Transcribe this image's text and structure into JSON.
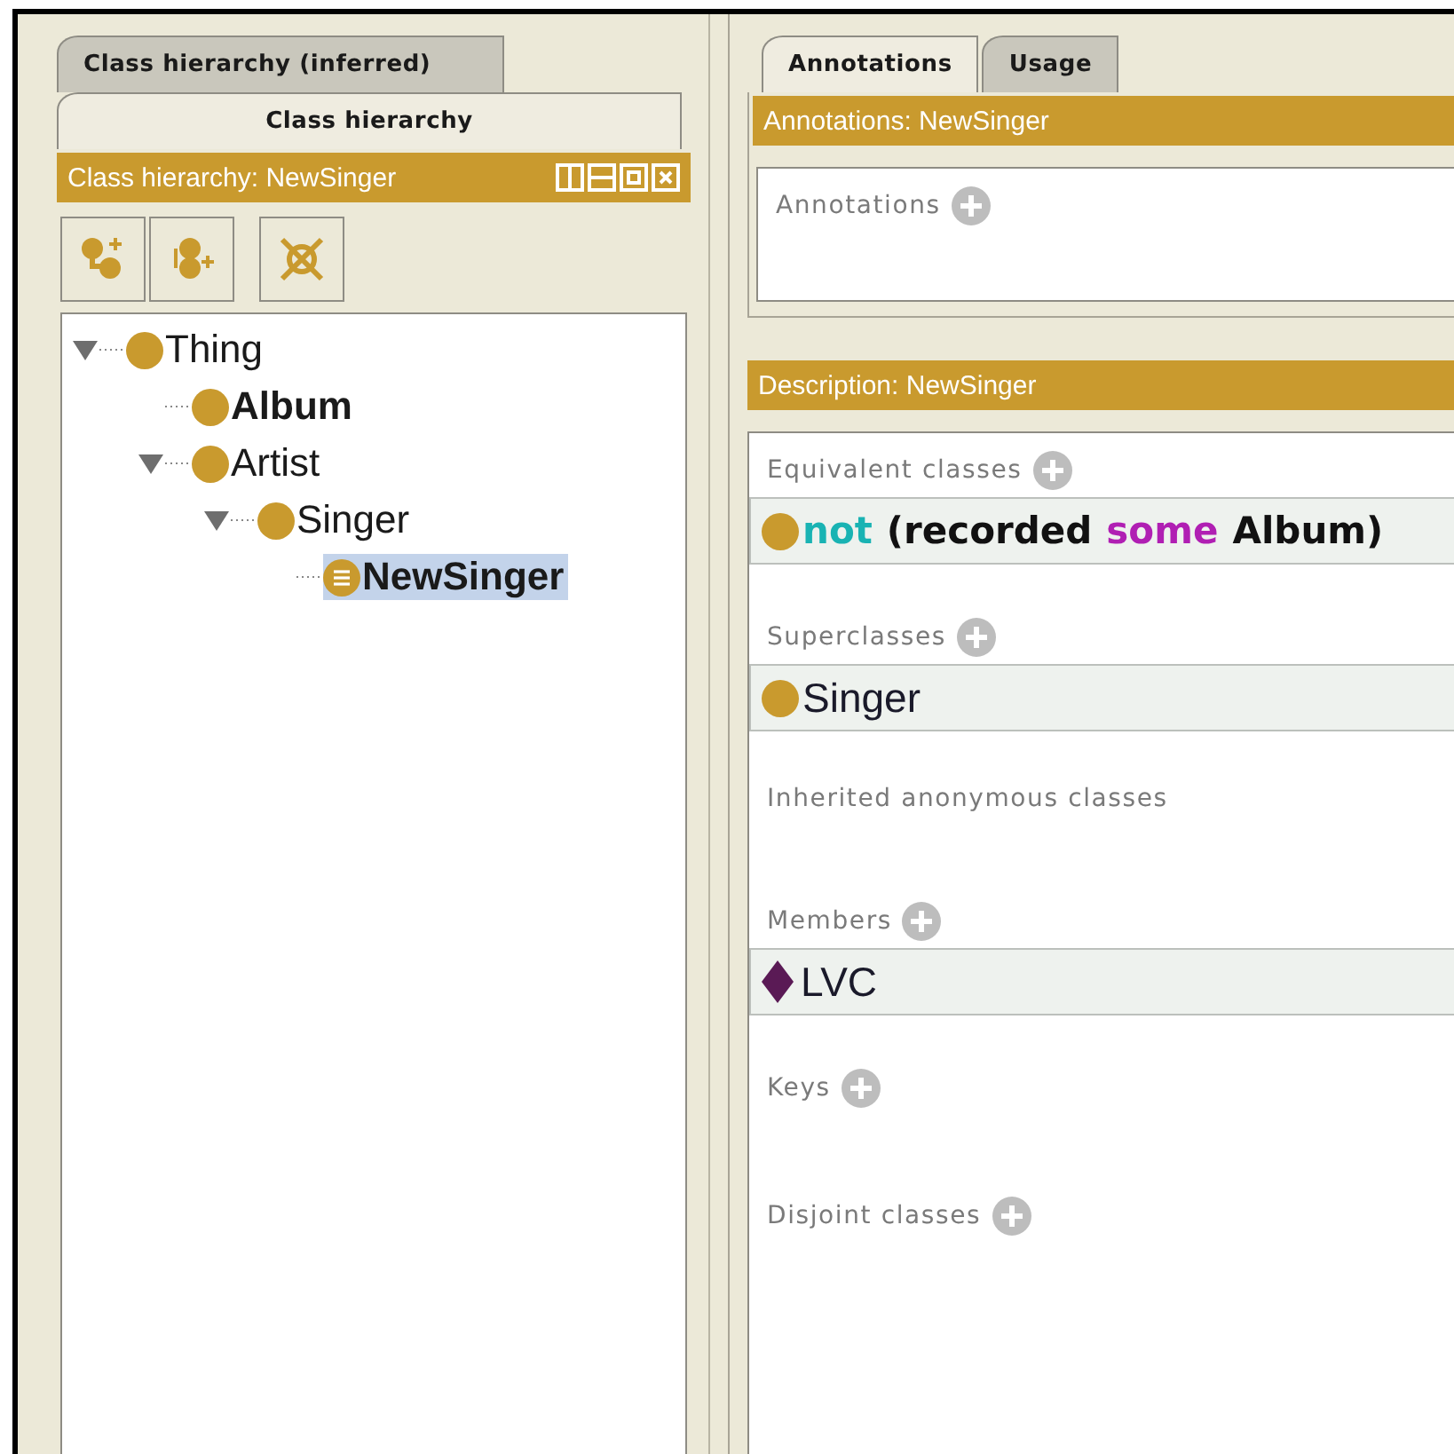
{
  "left_tabs": [
    {
      "label": "Class hierarchy (inferred)",
      "selected": false
    },
    {
      "label": "Class hierarchy",
      "selected": true
    }
  ],
  "hierarchy_header": {
    "title": "Class hierarchy: NewSinger"
  },
  "tree": [
    {
      "label": "Thing",
      "kind": "primitive",
      "bold": false,
      "selected": false,
      "expanded": true,
      "children": [
        {
          "label": "Album",
          "kind": "primitive",
          "bold": true,
          "selected": false
        },
        {
          "label": "Artist",
          "kind": "primitive",
          "bold": false,
          "selected": false,
          "expanded": true,
          "children": [
            {
              "label": "Singer",
              "kind": "primitive",
              "bold": false,
              "selected": false,
              "expanded": true,
              "children": [
                {
                  "label": "NewSinger",
                  "kind": "defined",
                  "bold": true,
                  "selected": true
                }
              ]
            }
          ]
        }
      ]
    }
  ],
  "right_tabs": [
    {
      "label": "Annotations",
      "selected": true
    },
    {
      "label": "Usage",
      "selected": false
    }
  ],
  "annotations_header": {
    "title": "Annotations: NewSinger"
  },
  "annotation_sections": [
    {
      "label": "Annotations",
      "addable": true
    }
  ],
  "description_header": {
    "title": "Description: NewSinger"
  },
  "description_sections": [
    {
      "label": "Equivalent classes",
      "addable": true,
      "items": [
        {
          "kind": "class",
          "parts": [
            {
              "kind": "keyword",
              "text": "not"
            },
            {
              "kind": "plain",
              "text": "(recorded"
            },
            {
              "kind": "quantifier",
              "text": "some"
            },
            {
              "kind": "plain",
              "text": "Album)"
            }
          ]
        }
      ]
    },
    {
      "label": "Superclasses",
      "addable": true,
      "items": [
        {
          "kind": "class",
          "parts": [
            {
              "kind": "name",
              "text": "Singer"
            }
          ]
        }
      ]
    },
    {
      "label": "Inherited anonymous classes",
      "addable": false
    },
    {
      "label": "Members",
      "addable": true,
      "items": [
        {
          "kind": "individual",
          "parts": [
            {
              "kind": "name",
              "text": "LVC"
            }
          ]
        }
      ]
    },
    {
      "label": "Keys",
      "addable": true
    },
    {
      "label": "Disjoint classes",
      "addable": true
    }
  ]
}
